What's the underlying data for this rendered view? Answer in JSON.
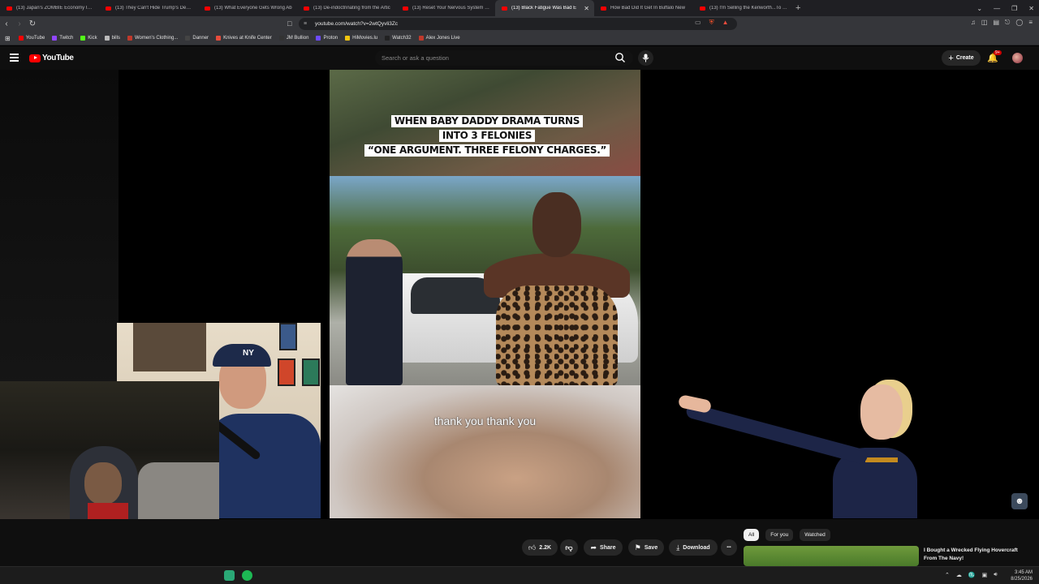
{
  "browser": {
    "tabs": [
      {
        "label": "(13) Japan's ZOMBIE Economy Is Ab"
      },
      {
        "label": "(13) They Can't Hide Trump's Demen"
      },
      {
        "label": "(13) What Everyone Gets Wrong Ab"
      },
      {
        "label": "(13) De-indoctrinating from the Artic"
      },
      {
        "label": "(13) Reset Your Nervous System in 3"
      },
      {
        "label": "(13) Black Fatigue Was Bad E"
      },
      {
        "label": "How Bad Did It Get In Buffalo New"
      },
      {
        "label": "(13) I'm Selling the Kenworth...To Bu"
      }
    ],
    "active_tab_index": 5,
    "new_tab_glyph": "+",
    "url": "youtube.com/watch?v=2wtQyvli3Zc",
    "bookmarks": [
      {
        "label": "YouTube",
        "color": "#ff0000"
      },
      {
        "label": "Twitch",
        "color": "#9146ff"
      },
      {
        "label": "Kick",
        "color": "#53fc18"
      },
      {
        "label": "bills",
        "color": "#bbbbbb"
      },
      {
        "label": "Women's Clothing...",
        "color": "#c0392b"
      },
      {
        "label": "Danner",
        "color": "#444444"
      },
      {
        "label": "Knives at Knife Center",
        "color": "#e74c3c"
      },
      {
        "label": "JM Bullion",
        "color": "#333333"
      },
      {
        "label": "Proton",
        "color": "#6d4aff"
      },
      {
        "label": "HiMovies.lu",
        "color": "#f1c40f"
      },
      {
        "label": "Watch32",
        "color": "#222222"
      },
      {
        "label": "Alex Jones Live",
        "color": "#c0392b"
      }
    ]
  },
  "youtube": {
    "logo_text": "YouTube",
    "search_placeholder": "Search or ask a question",
    "create_label": "Create",
    "notification_count": "9+"
  },
  "video": {
    "caption_lines": [
      "WHEN BABY DADDY DRAMA TURNS",
      "INTO 3 FELONIES",
      "“ONE ARGUMENT. THREE FELONY CHARGES.”"
    ],
    "subtitle": "thank you thank you",
    "host_cap_logo": "NY"
  },
  "actions": {
    "like_count": "2.2K",
    "share_label": "Share",
    "save_label": "Save",
    "download_label": "Download",
    "more_label": "•••"
  },
  "recommendations": {
    "chips": [
      {
        "label": "All",
        "active": true
      },
      {
        "label": "For you",
        "active": false
      },
      {
        "label": "Watched",
        "active": false
      }
    ],
    "first_title": "I Bought a Wrecked Flying Hovercraft From The Navy!"
  },
  "taskbar": {
    "time": "3:45 AM",
    "date": "8/25/2026"
  }
}
